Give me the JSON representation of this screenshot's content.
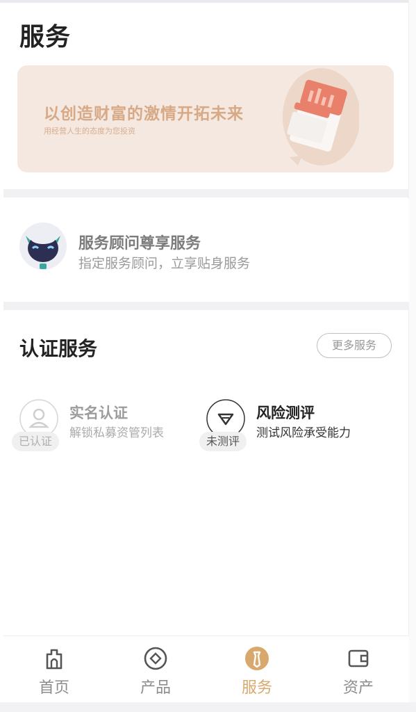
{
  "header": {
    "title": "服务"
  },
  "banner": {
    "title": "以创造财富的激情开拓未来",
    "subtitle": "用经营人生的态度为您投资"
  },
  "advisor": {
    "title": "服务顾问尊享服务",
    "subtitle": "指定服务顾问，立享贴身服务",
    "icon": "robot-avatar-icon"
  },
  "certification": {
    "title": "认证服务",
    "more_label": "更多服务",
    "items": [
      {
        "title": "实名认证",
        "subtitle": "解锁私募资管列表",
        "badge": "已认证",
        "icon": "user-icon",
        "state": "done"
      },
      {
        "title": "风险测评",
        "subtitle": "测试风险承受能力",
        "badge": "未测评",
        "icon": "diamond-icon",
        "state": "pending"
      }
    ]
  },
  "tabbar": {
    "items": [
      {
        "label": "首页",
        "icon": "home-icon"
      },
      {
        "label": "产品",
        "icon": "product-icon"
      },
      {
        "label": "服务",
        "icon": "service-icon",
        "active": true
      },
      {
        "label": "资产",
        "icon": "wallet-icon"
      }
    ]
  },
  "colors": {
    "accent": "#d9a86c",
    "banner_bg": "#f4e8e0",
    "banner_text": "#d7a986",
    "divider": "#f1f1f3"
  }
}
